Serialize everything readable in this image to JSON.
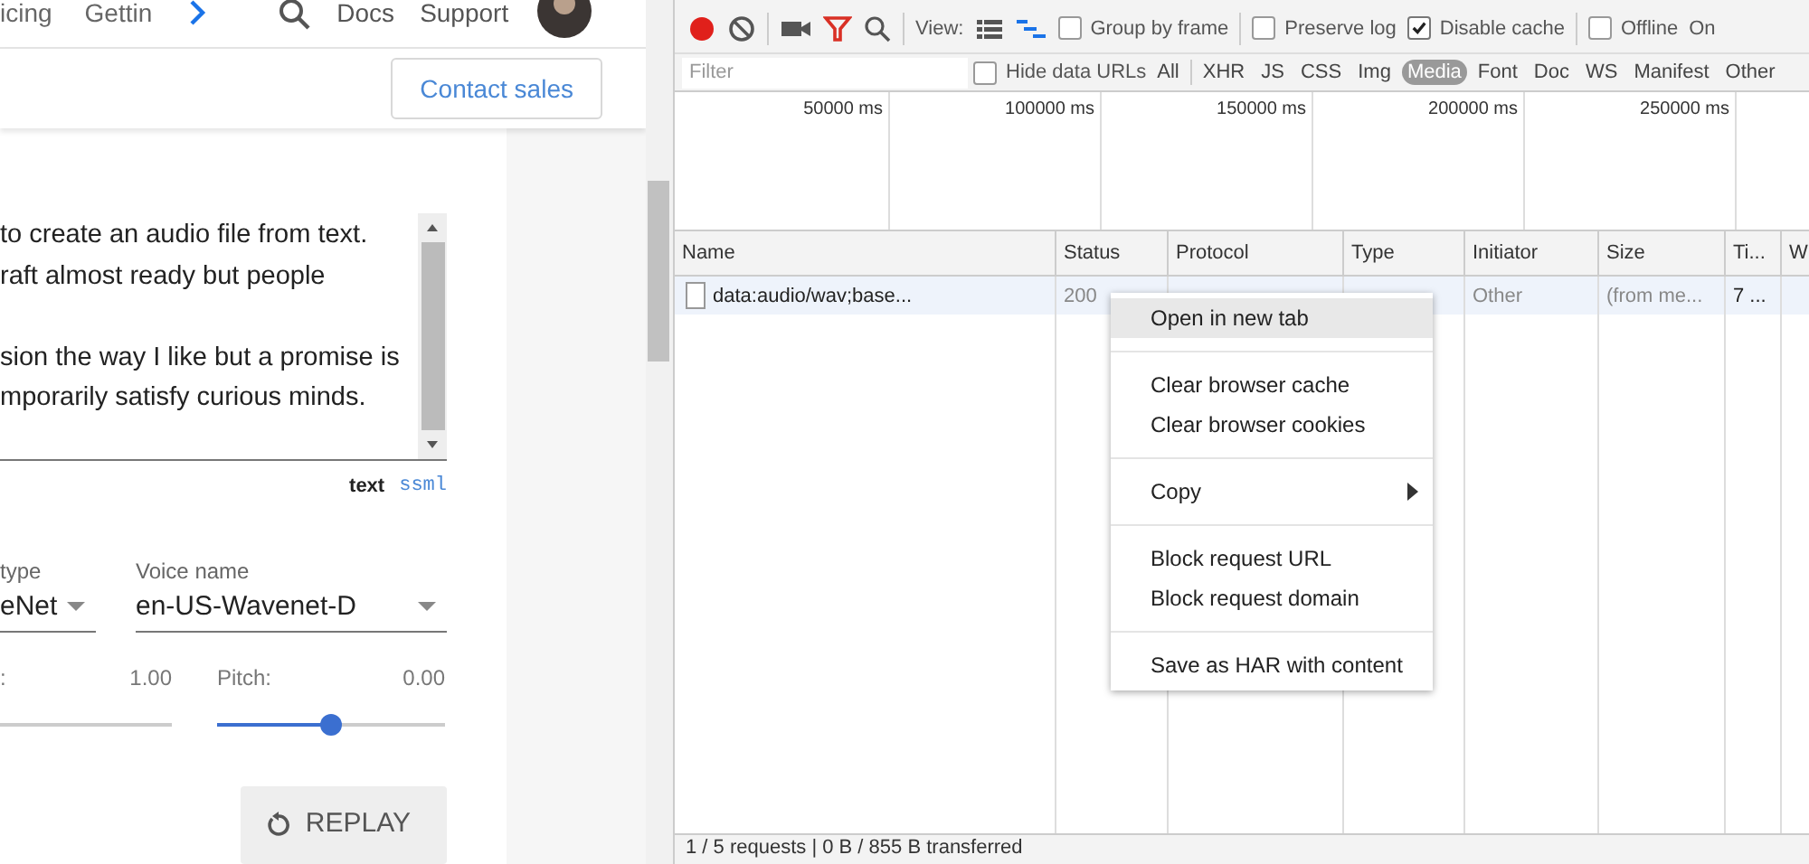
{
  "site_nav": {
    "links": [
      "icing",
      "Gettin"
    ],
    "right_links": [
      "Docs",
      "Support"
    ]
  },
  "contact_button": "Contact sales",
  "editor": {
    "paragraphs": [
      [
        "to create an audio file from text.",
        "raft almost ready but people"
      ],
      [
        "sion the way I like but a promise is",
        "mporarily satisfy curious minds."
      ]
    ]
  },
  "input_modes": [
    {
      "label": "text",
      "selected": true
    },
    {
      "label": "ssml",
      "selected": false
    }
  ],
  "voice_type": {
    "label": "type",
    "value": "eNet"
  },
  "voice_name": {
    "label": "Voice name",
    "value": "en-US-Wavenet-D"
  },
  "speed": {
    "label": ":",
    "reading": "1.00",
    "level": 0
  },
  "pitch": {
    "label": "Pitch:",
    "reading": "0.00",
    "level": 0.5
  },
  "replay_button": "REPLAY",
  "devtools": {
    "toolbar": {
      "recording": true,
      "view_label": "View:",
      "options": [
        {
          "label": "Group by frame",
          "checked": false
        },
        {
          "label": "Preserve log",
          "checked": false
        },
        {
          "label": "Disable cache",
          "checked": true
        },
        {
          "label": "Offline",
          "checked": false
        }
      ],
      "throttle": "On"
    },
    "filter": {
      "placeholder": "Filter",
      "hide_data_urls": {
        "label": "Hide data URLs",
        "checked": false
      },
      "types": [
        {
          "label": "All",
          "selected": false
        },
        {
          "label": "XHR",
          "selected": false
        },
        {
          "label": "JS",
          "selected": false
        },
        {
          "label": "CSS",
          "selected": false
        },
        {
          "label": "Img",
          "selected": false
        },
        {
          "label": "Media",
          "selected": true
        },
        {
          "label": "Font",
          "selected": false
        },
        {
          "label": "Doc",
          "selected": false
        },
        {
          "label": "WS",
          "selected": false
        },
        {
          "label": "Manifest",
          "selected": false
        },
        {
          "label": "Other",
          "selected": false
        }
      ]
    },
    "timeline_ticks": [
      "50000 ms",
      "100000 ms",
      "150000 ms",
      "200000 ms",
      "250000 ms"
    ],
    "table": {
      "columns": [
        "Name",
        "Status",
        "Protocol",
        "Type",
        "Initiator",
        "Size",
        "Ti...",
        "W"
      ],
      "rows": [
        {
          "selected": true,
          "cells": [
            "data:audio/wav;base...",
            "200",
            "",
            "",
            "Other",
            "(from me...",
            "7 ..."
          ]
        }
      ]
    },
    "context_menu": [
      [
        {
          "label": "Open in new tab",
          "selected": true,
          "has_submenu": false
        }
      ],
      [
        {
          "label": "Clear browser cache",
          "selected": false,
          "has_submenu": false
        },
        {
          "label": "Clear browser cookies",
          "selected": false,
          "has_submenu": false
        }
      ],
      [
        {
          "label": "Copy",
          "selected": false,
          "has_submenu": true
        }
      ],
      [
        {
          "label": "Block request URL",
          "selected": false,
          "has_submenu": false
        },
        {
          "label": "Block request domain",
          "selected": false,
          "has_submenu": false
        }
      ],
      [
        {
          "label": "Save as HAR with content",
          "selected": false,
          "has_submenu": false
        }
      ]
    ],
    "status_bar": "1 / 5 requests | 0 B / 855 B transferred"
  }
}
